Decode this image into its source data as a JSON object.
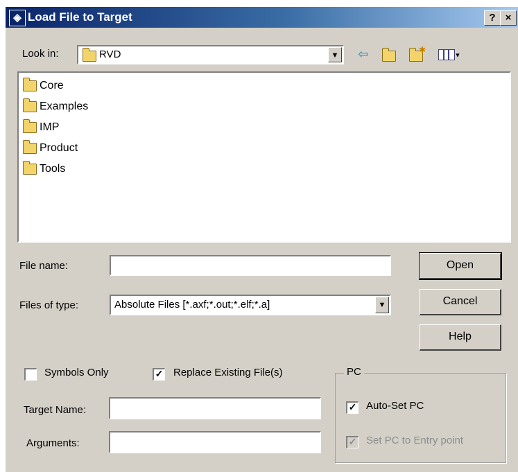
{
  "window": {
    "title": "Load File to Target",
    "help_button": "?",
    "close_button": "×"
  },
  "lookin": {
    "label": "Look in:",
    "value": "RVD"
  },
  "toolbar": {
    "icons": [
      "back-arrow-icon",
      "up-folder-icon",
      "new-folder-icon",
      "view-menu-icon"
    ]
  },
  "file_list": [
    {
      "name": "Core",
      "icon": "folder-icon"
    },
    {
      "name": "Examples",
      "icon": "folder-icon"
    },
    {
      "name": "IMP",
      "icon": "folder-icon"
    },
    {
      "name": "Product",
      "icon": "folder-icon"
    },
    {
      "name": "Tools",
      "icon": "folder-icon"
    }
  ],
  "filename": {
    "label": "File name:",
    "value": ""
  },
  "filetype": {
    "label": "Files of type:",
    "value": "Absolute Files [*.axf;*.out;*.elf;*.a]"
  },
  "buttons": {
    "open": "Open",
    "cancel": "Cancel",
    "help": "Help"
  },
  "options": {
    "symbols_only": {
      "label": "Symbols Only",
      "checked": false
    },
    "replace_existing": {
      "label": "Replace Existing File(s)",
      "checked": true
    }
  },
  "target_name": {
    "label": "Target Name:",
    "value": ""
  },
  "arguments": {
    "label": "Arguments:",
    "value": ""
  },
  "pc_group": {
    "title": "PC",
    "auto_set": {
      "label": "Auto-Set PC",
      "checked": true
    },
    "set_entry": {
      "label": "Set PC to Entry point",
      "checked": true,
      "disabled": true
    }
  }
}
